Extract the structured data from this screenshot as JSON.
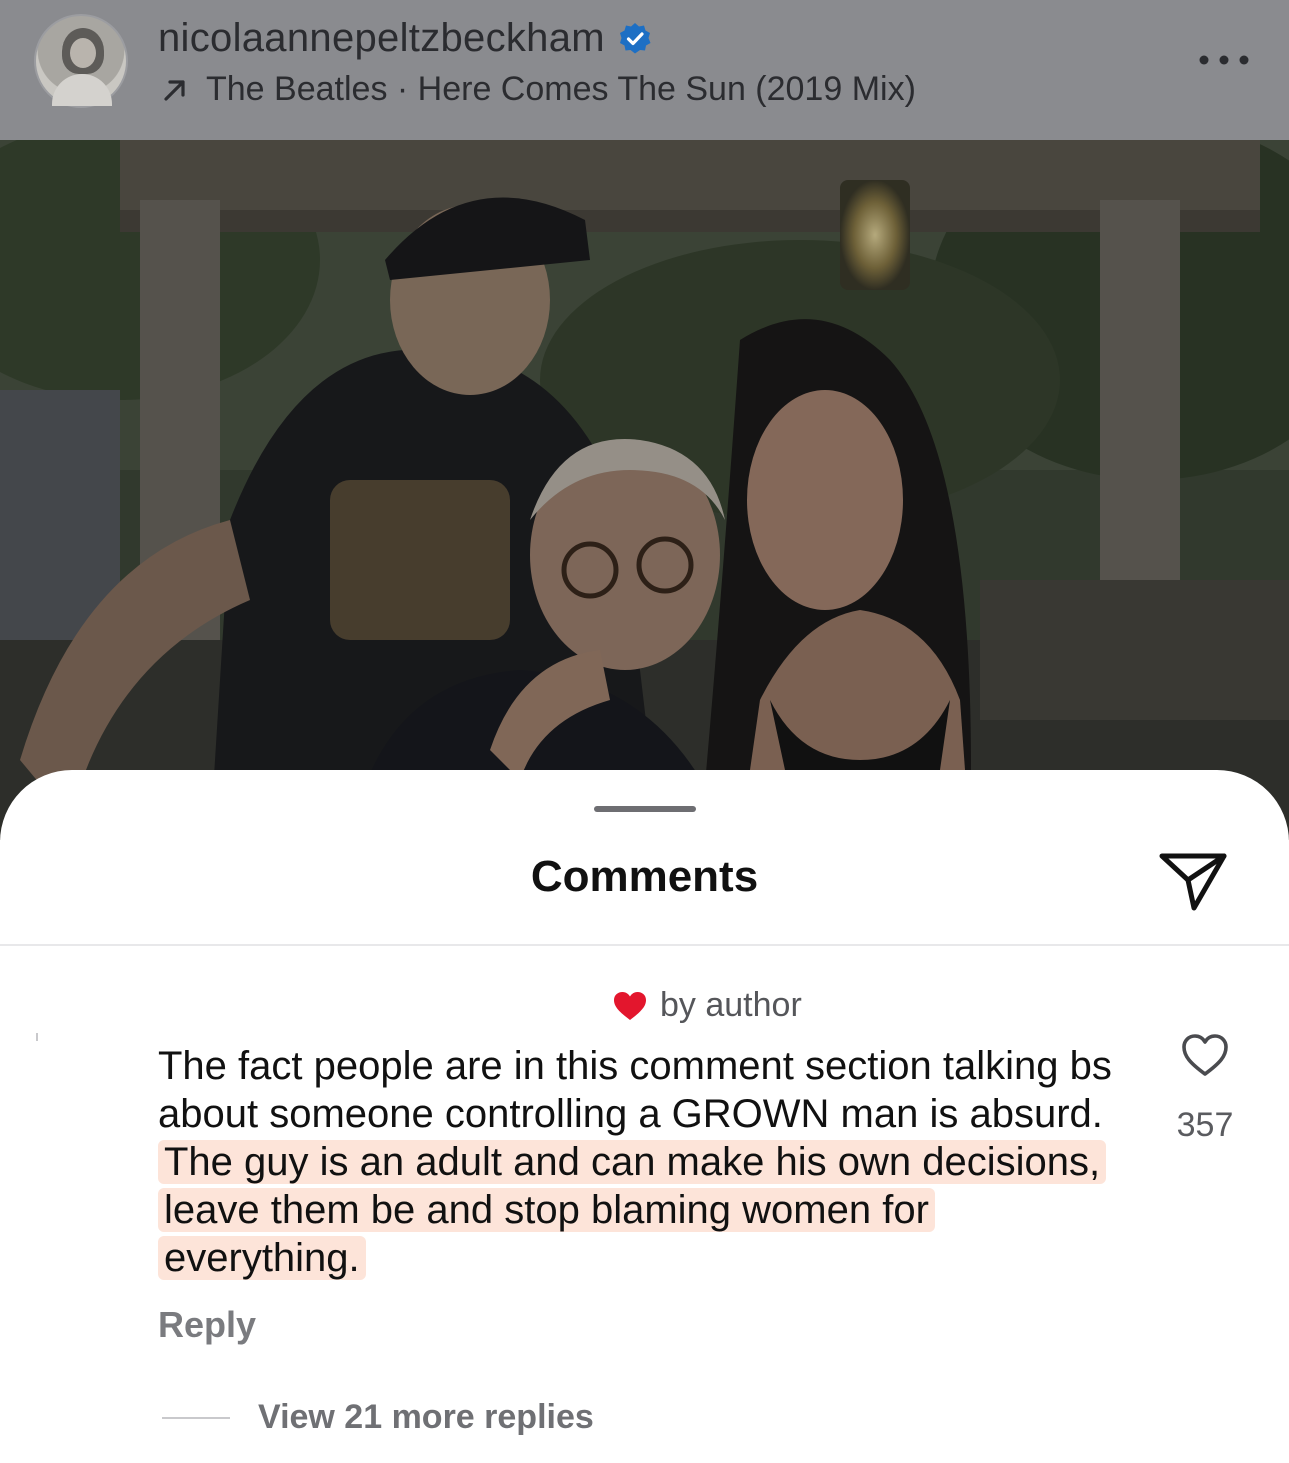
{
  "post": {
    "username": "nicolaannepeltzbeckham",
    "verified": true,
    "music": "The Beatles · Here Comes The Sun (2019 Mix)",
    "more_icon": "more-horizontal-icon"
  },
  "sheet": {
    "title": "Comments",
    "share_icon": "paper-plane-icon"
  },
  "comment": {
    "liked_by_author": "by author",
    "text_plain": "The fact people are in this comment section talking bs about someone controlling a GROWN man is absurd.",
    "text_highlighted": "The guy is an adult and can make his own decisions, leave them be and stop blaming women for everything.",
    "like_count": "357",
    "reply_label": "Reply",
    "view_replies_label": "View 21 more replies"
  },
  "colors": {
    "verified_blue": "#1d6fc4",
    "liked_heart_red": "#e3162d",
    "highlight": "#fde4d9"
  }
}
